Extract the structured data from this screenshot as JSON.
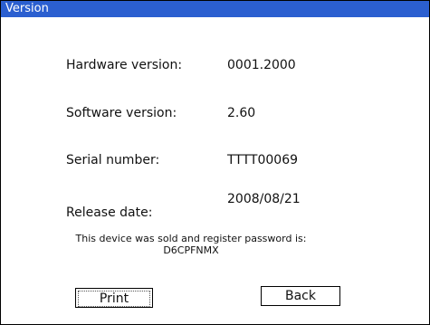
{
  "window": {
    "title": "Version",
    "titlebar_color": "#2b5fd0"
  },
  "info": {
    "hardware_label": "Hardware version:",
    "hardware_value": "0001.2000",
    "software_label": "Software version:",
    "software_value": "2.60",
    "serial_label": "Serial number:",
    "serial_value": "TTTT00069",
    "release_label": "Release date:",
    "release_value": "2008/08/21"
  },
  "notice": {
    "line1": "This device was sold and register password is:",
    "password": "D6CPFNMX"
  },
  "buttons": {
    "print": "Print",
    "back": "Back"
  }
}
